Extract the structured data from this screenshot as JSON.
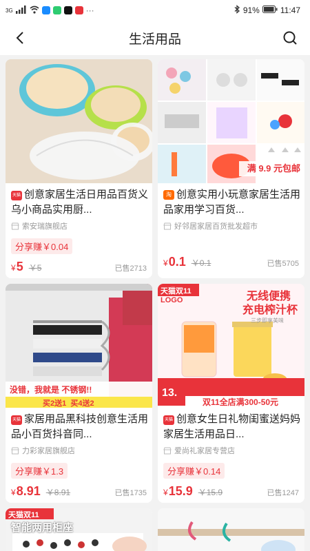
{
  "status_bar": {
    "network": "4G",
    "signal_text": "3G",
    "more": "···",
    "battery": "91%",
    "time": "11:47"
  },
  "header": {
    "title": "生活用品",
    "back_icon": "chevron-left-icon",
    "search_icon": "search-icon"
  },
  "products": [
    {
      "name": "创意家居生活日用品百货义乌小商品实用厨...",
      "badge": "天猫",
      "badge_color": "#e8333a",
      "shop": "索安瑞旗舰店",
      "share": "分享赚￥0.04",
      "price": "5",
      "orig": "￥5",
      "sold": "已售2713"
    },
    {
      "name": "创意实用小玩意家居生活用品家用学习百货...",
      "badge": "淘",
      "badge_color": "#ff6a00",
      "shop": "好邻居家居百货批发超市",
      "share": "",
      "price": "0.1",
      "orig": "￥0.1",
      "sold": "已售5705",
      "promo": "满 9.9 元包邮"
    },
    {
      "name": "家居用品黑科技创意生活用品小百货抖音同...",
      "badge": "天猫",
      "badge_color": "#e8333a",
      "shop": "力彩家居旗舰店",
      "share": "分享赚￥1.3",
      "price": "8.91",
      "orig": "￥8.91",
      "sold": "已售1735",
      "banner1": "没错，我就是 不锈钢!!",
      "banner2": "买2送1  买4送2"
    },
    {
      "name": "创意女生日礼物闺蜜送妈妈家居生活用品日...",
      "badge": "天猫",
      "badge_color": "#e8333a",
      "shop": "爱尚礼家居专营店",
      "share": "分享赚￥0.14",
      "price": "15.9",
      "orig": "￥15.9",
      "sold": "已售1247",
      "tag1": "天猫双11",
      "tag2": "LOGO",
      "headline1": "无线便携",
      "headline2": "充电榨汁杯",
      "headline3": "三步即享美味",
      "promo_price": "13.",
      "promo_text": "双11全店满300-50元"
    },
    {
      "tag": "天猫双11",
      "caption": "智能两用柜座"
    },
    {}
  ],
  "colors": {
    "accent": "#e8333a",
    "share_bg": "#fdeaea",
    "page_bg": "#f2f2f2"
  }
}
